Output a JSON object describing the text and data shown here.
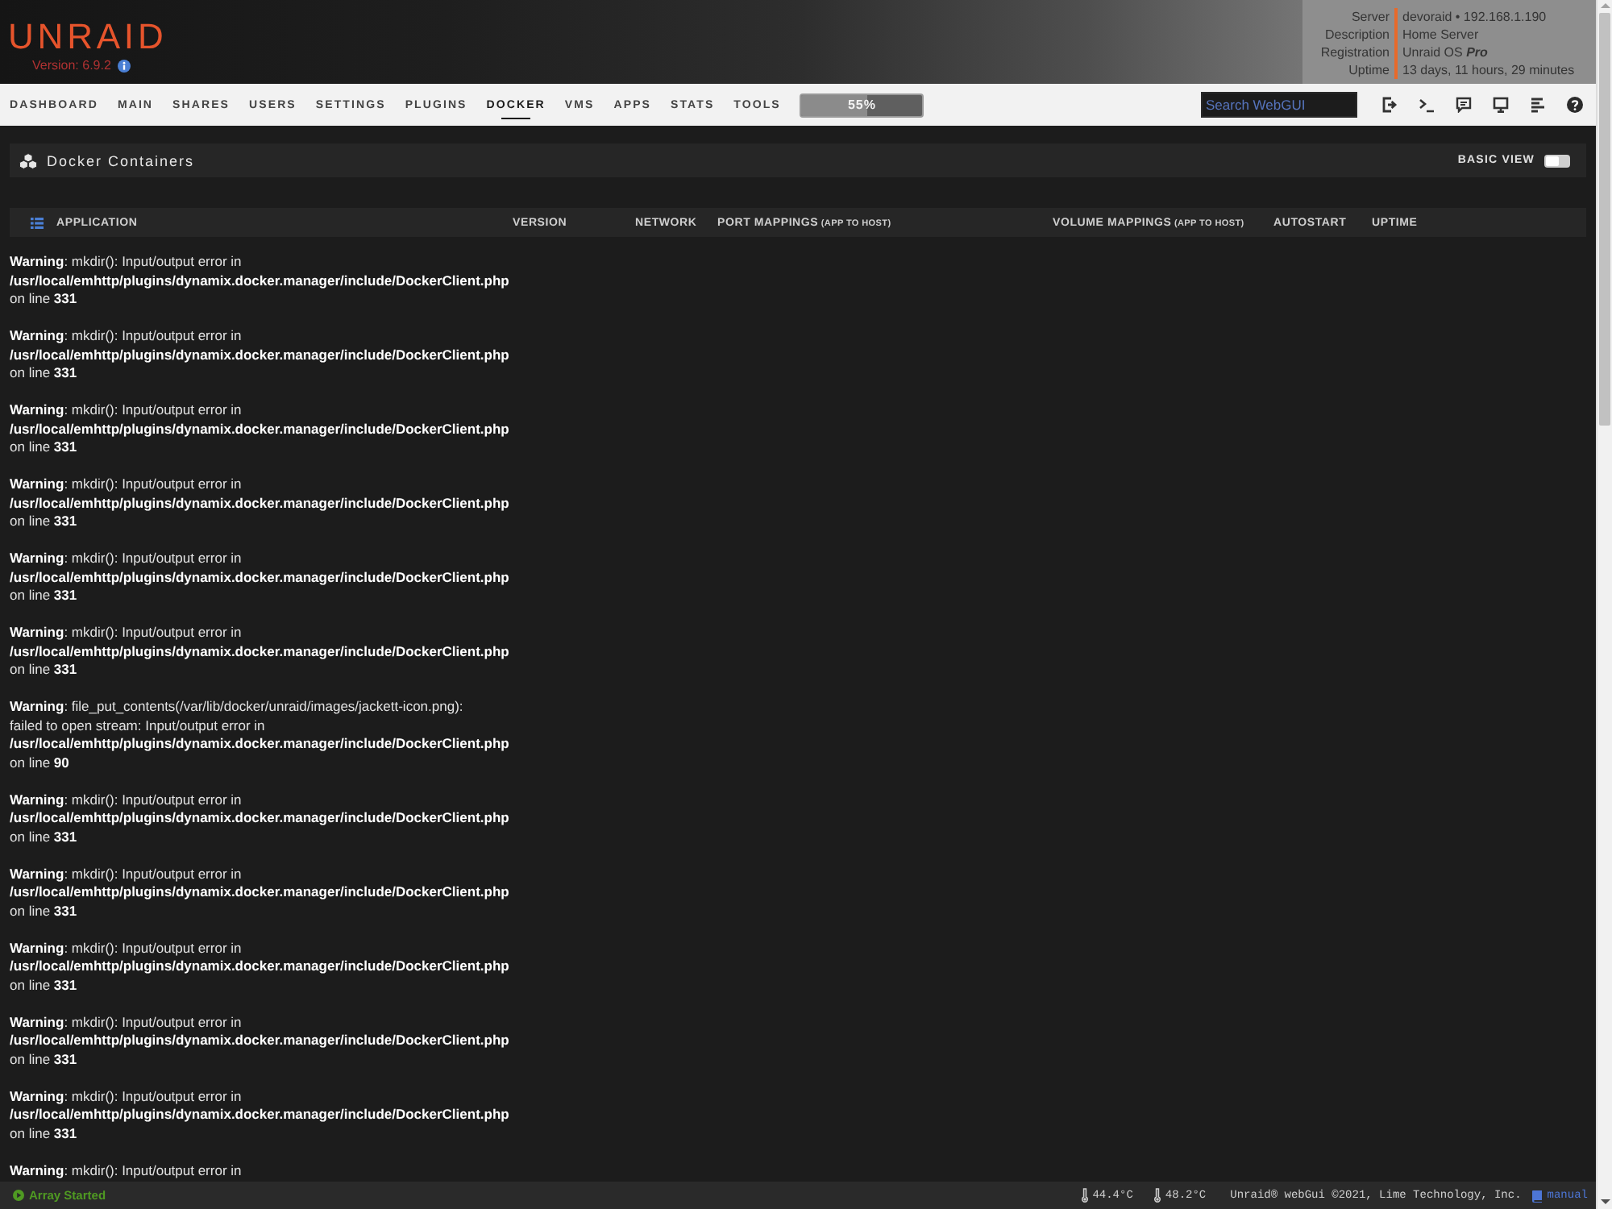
{
  "header": {
    "logo": "UNRAID",
    "version": "Version: 6.9.2",
    "server_info": [
      {
        "label": "Server",
        "value": "devoraid • 192.168.1.190"
      },
      {
        "label": "Description",
        "value": "Home Server"
      },
      {
        "label": "Registration",
        "value": "Unraid OS **Pro**"
      },
      {
        "label": "Uptime",
        "value": "13 days, 11 hours, 29 minutes"
      }
    ]
  },
  "nav": {
    "items": [
      {
        "label": "DASHBOARD",
        "selected": false
      },
      {
        "label": "MAIN",
        "selected": false
      },
      {
        "label": "SHARES",
        "selected": false
      },
      {
        "label": "USERS",
        "selected": false
      },
      {
        "label": "SETTINGS",
        "selected": false
      },
      {
        "label": "PLUGINS",
        "selected": false
      },
      {
        "label": "DOCKER",
        "selected": true
      },
      {
        "label": "VMS",
        "selected": false
      },
      {
        "label": "APPS",
        "selected": false
      },
      {
        "label": "STATS",
        "selected": false
      },
      {
        "label": "TOOLS",
        "selected": false
      }
    ],
    "progress": {
      "label": "55%",
      "level": 0.55
    },
    "search": {
      "placeholder": "Search WebGUI"
    }
  },
  "docker_panel": {
    "title": "Docker Containers",
    "basic_view": {
      "label": "BASIC VIEW",
      "on": false
    }
  },
  "table": {
    "columns": [
      {
        "label": "APPLICATION"
      },
      {
        "label": "VERSION"
      },
      {
        "label": "NETWORK"
      },
      {
        "label": "PORT MAPPINGS",
        "note": "(APP TO HOST)"
      },
      {
        "label": "VOLUME MAPPINGS",
        "note": "(APP TO HOST)"
      },
      {
        "label": "AUTOSTART"
      },
      {
        "label": "UPTIME"
      }
    ]
  },
  "warnings": [
    "**Warning**: mkdir(): Input/output error in\n**/usr/local/emhttp/plugins/dynamix.docker.manager/include/DockerClient.php**\non line **331**",
    "**Warning**: mkdir(): Input/output error in\n**/usr/local/emhttp/plugins/dynamix.docker.manager/include/DockerClient.php**\non line **331**",
    "**Warning**: mkdir(): Input/output error in\n**/usr/local/emhttp/plugins/dynamix.docker.manager/include/DockerClient.php**\non line **331**",
    "**Warning**: mkdir(): Input/output error in\n**/usr/local/emhttp/plugins/dynamix.docker.manager/include/DockerClient.php**\non line **331**",
    "**Warning**: mkdir(): Input/output error in\n**/usr/local/emhttp/plugins/dynamix.docker.manager/include/DockerClient.php**\non line **331**",
    "**Warning**: mkdir(): Input/output error in\n**/usr/local/emhttp/plugins/dynamix.docker.manager/include/DockerClient.php**\non line **331**",
    "**Warning**: file_put_contents(/var/lib/docker/unraid/images/jackett-icon.png):\nfailed to open stream: Input/output error in\n**/usr/local/emhttp/plugins/dynamix.docker.manager/include/DockerClient.php**\non line **90**",
    "**Warning**: mkdir(): Input/output error in\n**/usr/local/emhttp/plugins/dynamix.docker.manager/include/DockerClient.php**\non line **331**",
    "**Warning**: mkdir(): Input/output error in\n**/usr/local/emhttp/plugins/dynamix.docker.manager/include/DockerClient.php**\non line **331**",
    "**Warning**: mkdir(): Input/output error in\n**/usr/local/emhttp/plugins/dynamix.docker.manager/include/DockerClient.php**\non line **331**",
    "**Warning**: mkdir(): Input/output error in\n**/usr/local/emhttp/plugins/dynamix.docker.manager/include/DockerClient.php**\non line **331**",
    "**Warning**: mkdir(): Input/output error in\n**/usr/local/emhttp/plugins/dynamix.docker.manager/include/DockerClient.php**\non line **331**",
    "**Warning**: mkdir(): Input/output error in"
  ],
  "status_bar": {
    "array_status": "Array Started",
    "temperatures": [
      "44.4°C",
      "48.2°C"
    ],
    "copyright": "Unraid® webGui ©2021, Lime Technology, Inc.",
    "manual_link": "manual"
  }
}
